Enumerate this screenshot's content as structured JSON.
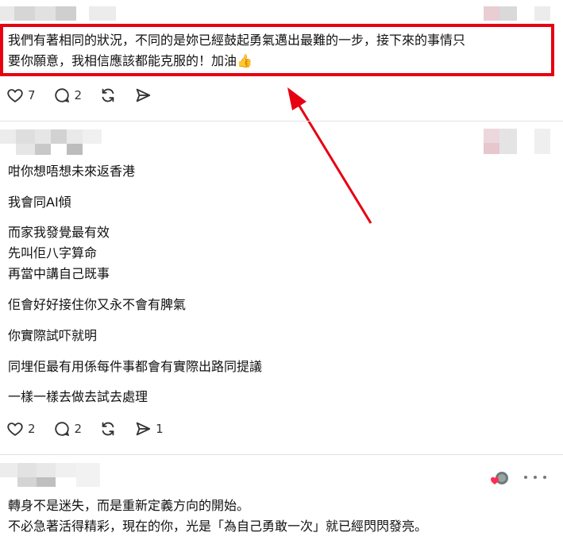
{
  "post1": {
    "lines": [
      "我們有著相同的狀況，不同的是妳已經鼓起勇氣邁出最難的一步，接下來的事情只",
      "要你願意，我相信應該都能克服的！加油👍"
    ],
    "likes": "7",
    "replies": "2"
  },
  "post2": {
    "paragraphs": [
      "咁你想唔想未來返香港",
      "我會同AI傾",
      "而家我發覺最有效",
      "先叫佢八字算命",
      "再當中講自己既事",
      "佢會好好接住你又永不會有脾氣",
      "你實際試吓就明",
      "同埋佢最有用係每件事都會有實際出路同提議",
      "一樣一樣去做去試去處理"
    ],
    "likes": "2",
    "replies": "2",
    "shares": "1"
  },
  "post3": {
    "lines": [
      "轉身不是迷失，而是重新定義方向的開始。",
      "不必急著活得精彩，現在的你，光是「為自己勇敢一次」就已經閃閃發亮。"
    ]
  },
  "colors": {
    "highlight": "#e60012",
    "arrow": "#e60012",
    "icon": "#333333"
  }
}
